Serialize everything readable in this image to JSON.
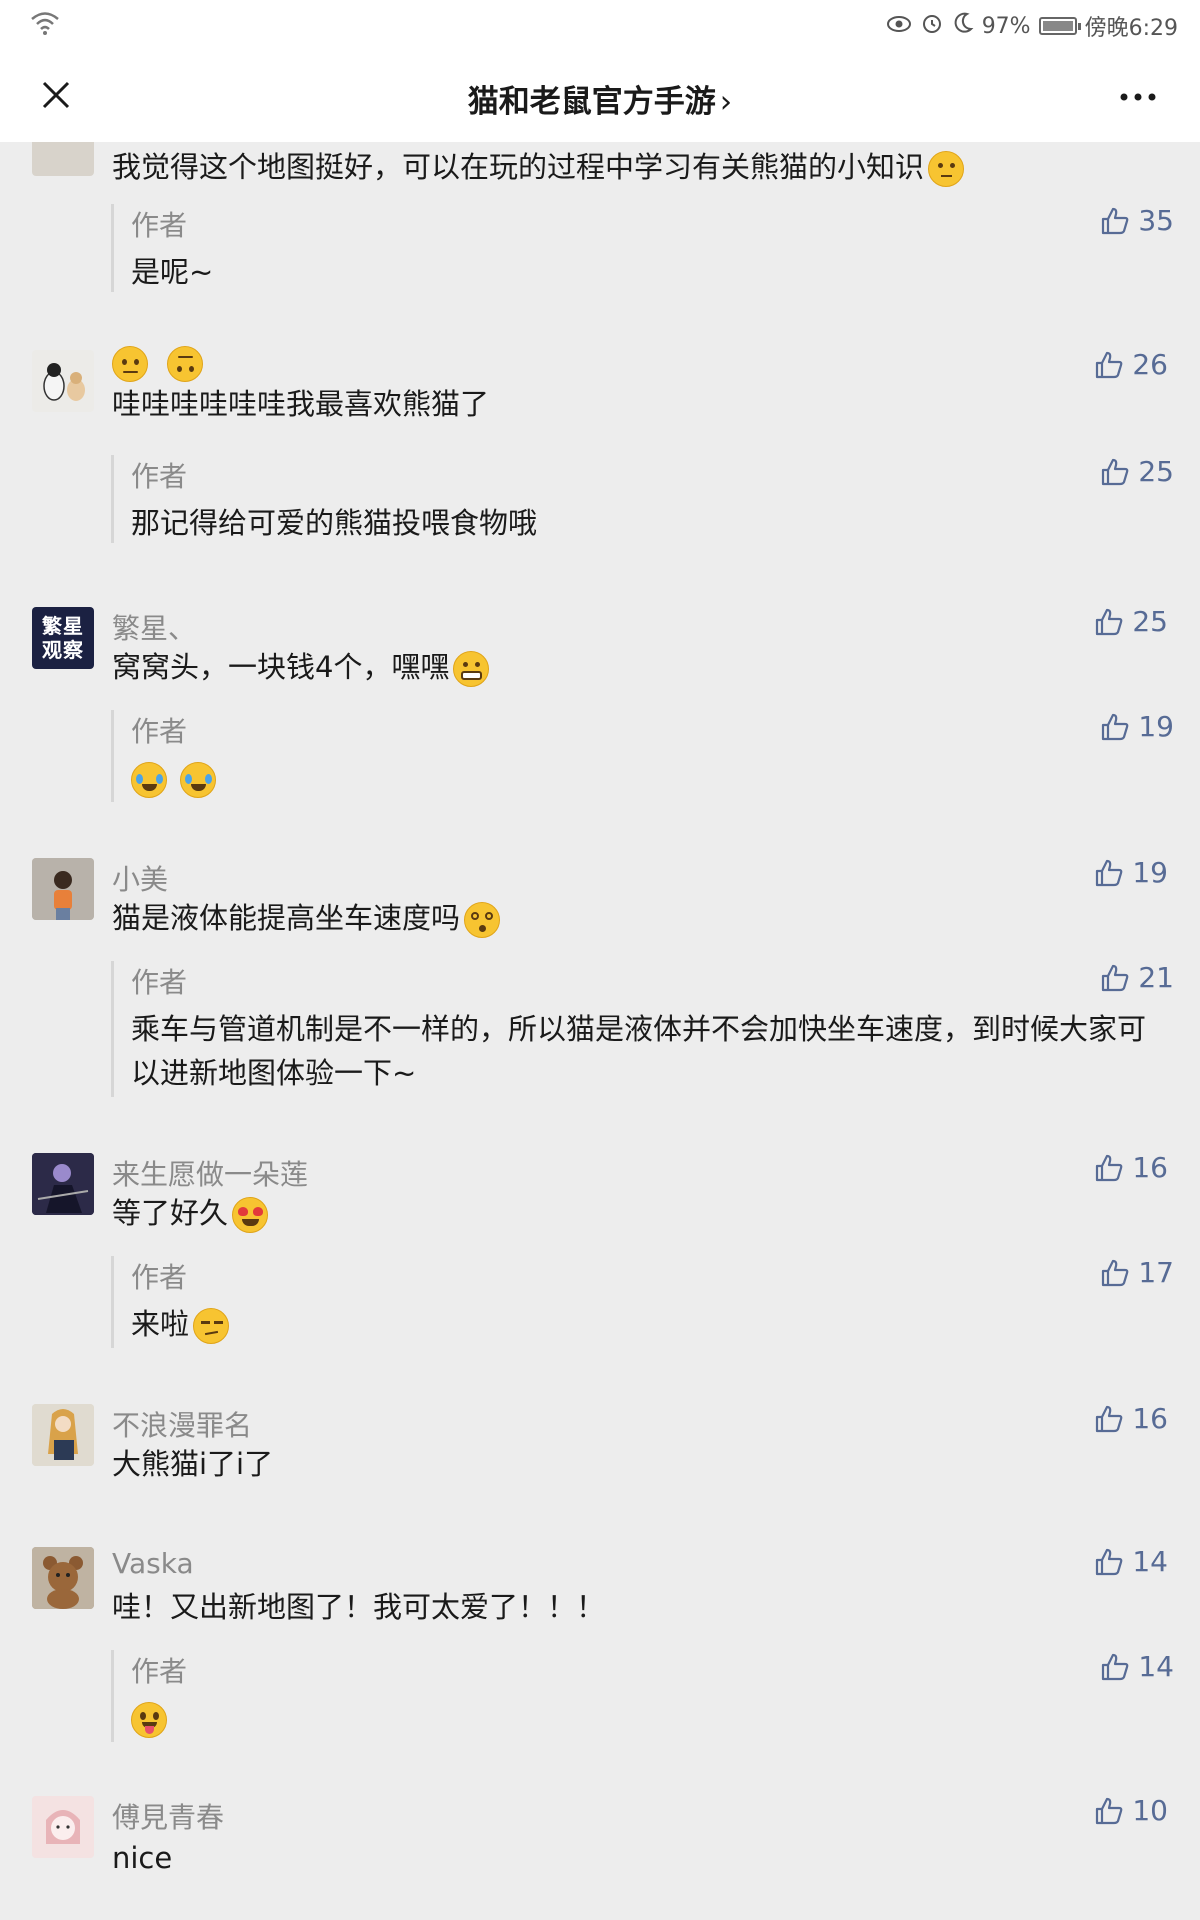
{
  "status_bar": {
    "battery": "97%",
    "time": "傍晚6:29"
  },
  "nav": {
    "title": "猫和老鼠官方手游",
    "chevron": "›"
  },
  "icons": {
    "like": "thumbs-up-icon",
    "close": "close-icon",
    "more": "more-icon"
  },
  "colors": {
    "like_count": "#576b95",
    "background": "#ededed"
  },
  "comments": [
    {
      "nickname": "",
      "text": "我觉得这个地图挺好，可以在玩的过程中学习有关熊猫的小知识",
      "likes": "35",
      "reply": {
        "label": "作者",
        "text": "是呢~"
      }
    },
    {
      "nickname": "",
      "text": "哇哇哇哇哇哇我最喜欢熊猫了",
      "likes": "26",
      "reply": {
        "label": "作者",
        "text": "那记得给可爱的熊猫投喂食物哦",
        "likes": "25"
      }
    },
    {
      "nickname": "繁星、",
      "text": "窝窝头，一块钱4个，嘿嘿",
      "likes": "25",
      "avatar_text": "繁星观察",
      "reply": {
        "label": "作者",
        "text": "",
        "likes": "19"
      }
    },
    {
      "nickname": "小美",
      "text": "猫是液体能提高坐车速度吗",
      "likes": "19",
      "reply": {
        "label": "作者",
        "text": "乘车与管道机制是不一样的，所以猫是液体并不会加快坐车速度，到时候大家可以进新地图体验一下~",
        "likes": "21"
      }
    },
    {
      "nickname": "来生愿做一朵莲",
      "text": "等了好久",
      "likes": "16",
      "reply": {
        "label": "作者",
        "text": "来啦",
        "likes": "17"
      }
    },
    {
      "nickname": "不浪漫罪名",
      "text": "大熊猫i了i了",
      "likes": "16"
    },
    {
      "nickname": "Vaska",
      "text": "哇！又出新地图了！我可太爱了！！！",
      "likes": "14",
      "reply": {
        "label": "作者",
        "text": "",
        "likes": "14"
      }
    },
    {
      "nickname": "傅見青春",
      "text": "nice",
      "likes": "10"
    }
  ]
}
